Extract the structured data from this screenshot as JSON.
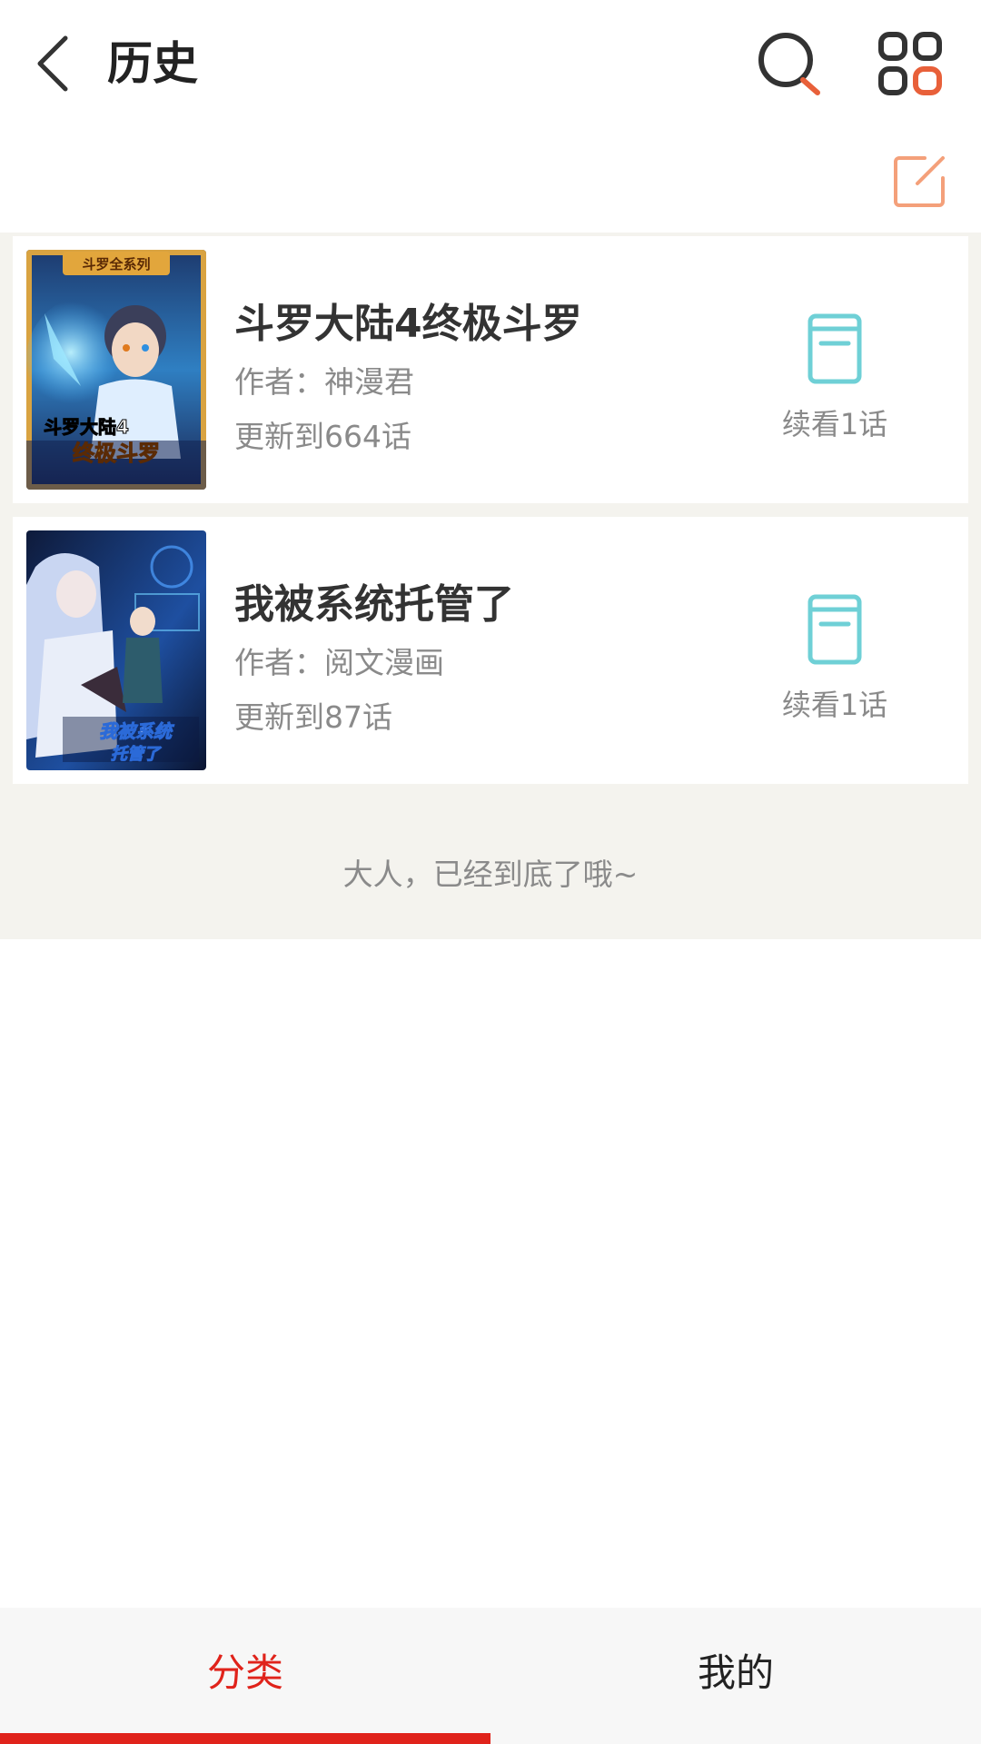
{
  "header": {
    "title": "历史",
    "back_icon": "chevron-left-icon",
    "search_icon": "search-icon",
    "menu_icon": "grid-menu-icon"
  },
  "toolbar": {
    "edit_icon": "edit-icon"
  },
  "history": [
    {
      "title": "斗罗大陆4终极斗罗",
      "author": "作者：神漫君",
      "update": "更新到664话",
      "continue_label": "续看1话",
      "continue_icon": "book-icon",
      "cover_badge": "斗罗全系列",
      "cover_title_line1": "斗罗大陆4",
      "cover_title_line2": "终极斗罗"
    },
    {
      "title": "我被系统托管了",
      "author": "作者：阅文漫画",
      "update": "更新到87话",
      "continue_label": "续看1话",
      "continue_icon": "book-icon",
      "cover_title_line1": "我被系统",
      "cover_title_line2": "托管了"
    }
  ],
  "list_end_text": "大人，已经到底了哦~",
  "bottom_nav": {
    "tabs": [
      {
        "label": "分类",
        "active": true
      },
      {
        "label": "我的",
        "active": false
      }
    ]
  },
  "colors": {
    "accent": "#e0231b",
    "edit_icon": "#f4a07a",
    "book_icon": "#6fd0d6",
    "list_background": "#f4f3ee"
  }
}
